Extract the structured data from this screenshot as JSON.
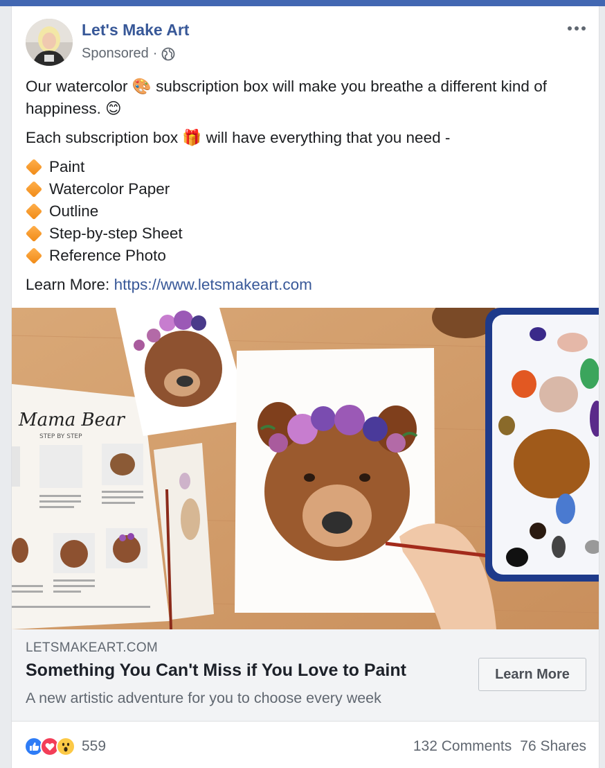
{
  "page": {
    "name": "Let's Make Art",
    "sponsored_label": "Sponsored",
    "separator": "·"
  },
  "post": {
    "line1": "Our watercolor 🎨 subscription box will make you breathe a different kind of happiness. 😊",
    "line2": "Each subscription box 🎁 will have everything that you need -",
    "bullets": [
      "Paint",
      "Watercolor Paper",
      "Outline",
      "Step-by-step Sheet",
      "Reference Photo"
    ],
    "learn_more_prefix": "Learn More:",
    "learn_more_url": "https://www.letsmakeart.com"
  },
  "image": {
    "sheet_title": "Mama Bear",
    "sheet_subtitle": "STEP BY STEP"
  },
  "link_preview": {
    "domain": "LETSMAKEART.COM",
    "headline": "Something You Can't Miss if You Love to Paint",
    "description": "A new artistic adventure for you to choose every week",
    "cta_label": "Learn More"
  },
  "footer": {
    "reaction_count": "559",
    "comments": "132 Comments",
    "shares": "76 Shares"
  },
  "colors": {
    "facebook_blue": "#4267b2",
    "link_blue": "#385898",
    "like": "#2e7cf6",
    "love": "#f33e58",
    "wow": "#fcc946"
  },
  "icons": [
    "globe-icon",
    "more-options-icon",
    "orange-diamond-icon",
    "like-reaction-icon",
    "love-reaction-icon",
    "wow-reaction-icon"
  ]
}
